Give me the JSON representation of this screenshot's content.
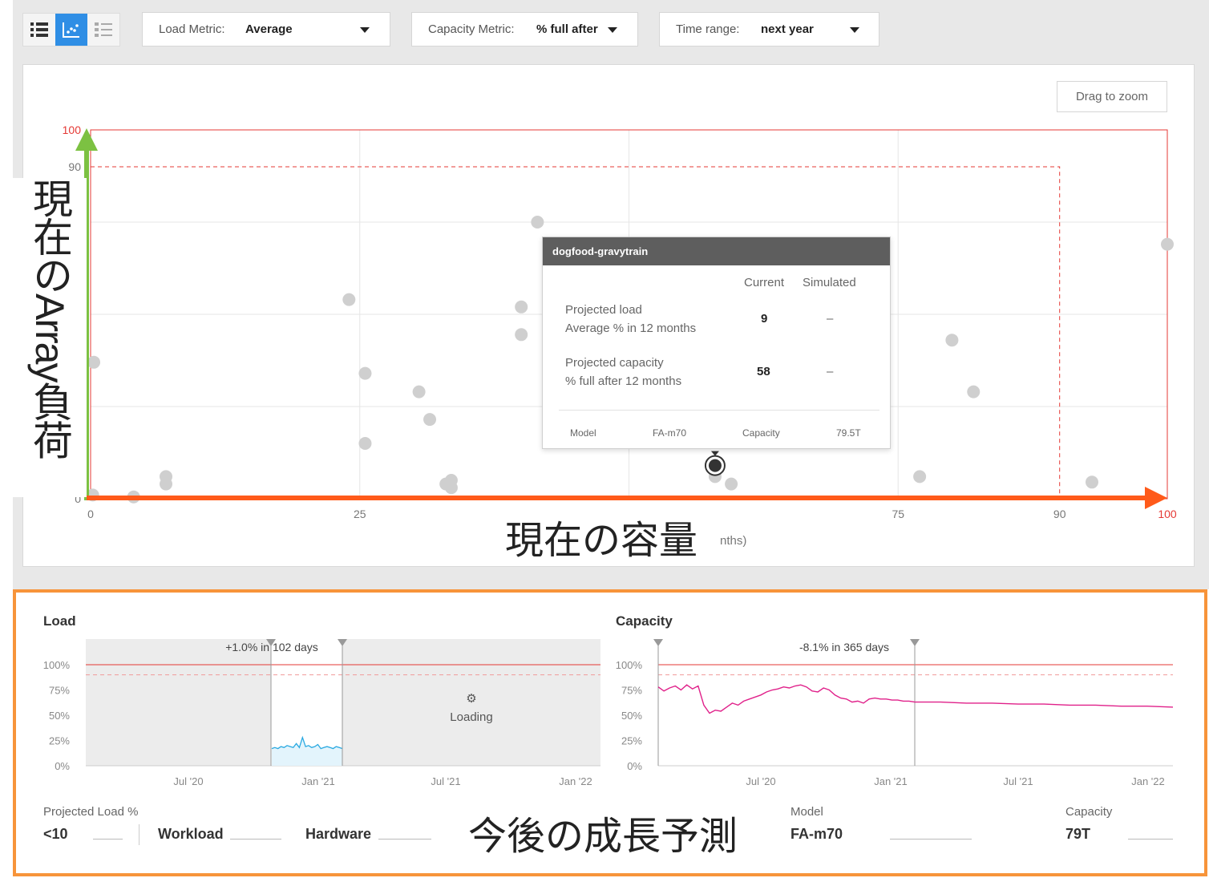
{
  "toolbar": {
    "view_icons": [
      "list-icon",
      "scatter-chart-icon",
      "detail-list-icon"
    ],
    "load_metric": {
      "label": "Load Metric:",
      "value": "Average"
    },
    "capacity_metric": {
      "label": "Capacity Metric:",
      "value": "% full after"
    },
    "time_range": {
      "label": "Time range:",
      "value": "next year"
    }
  },
  "scatter": {
    "zoom_button": "Drag to zoom",
    "x_axis_partial_label": "nths)",
    "accent_color": "#e53935",
    "chart_data": {
      "type": "scatter",
      "x_ticks": [
        "0",
        "25",
        "75",
        "90",
        "100"
      ],
      "y_ticks": [
        "100",
        "90",
        "0"
      ],
      "xlim": [
        0,
        100
      ],
      "ylim": [
        0,
        100
      ],
      "threshold": 90,
      "points": [
        {
          "x": 0.3,
          "y": 37
        },
        {
          "x": 0.2,
          "y": 1
        },
        {
          "x": 4,
          "y": 0.5
        },
        {
          "x": 7,
          "y": 6
        },
        {
          "x": 7,
          "y": 4
        },
        {
          "x": 24,
          "y": 54
        },
        {
          "x": 25.5,
          "y": 34
        },
        {
          "x": 25.5,
          "y": 15
        },
        {
          "x": 30.5,
          "y": 29
        },
        {
          "x": 31.5,
          "y": 21.5
        },
        {
          "x": 33,
          "y": 4
        },
        {
          "x": 33.5,
          "y": 3
        },
        {
          "x": 33.5,
          "y": 5
        },
        {
          "x": 40,
          "y": 52
        },
        {
          "x": 40,
          "y": 44.5
        },
        {
          "x": 41.5,
          "y": 75
        },
        {
          "x": 58,
          "y": 6
        },
        {
          "x": 59.5,
          "y": 4
        },
        {
          "x": 80,
          "y": 43
        },
        {
          "x": 82,
          "y": 29
        },
        {
          "x": 77,
          "y": 6
        },
        {
          "x": 93,
          "y": 4.5
        },
        {
          "x": 100,
          "y": 69
        }
      ],
      "selected_point": {
        "x": 58,
        "y": 9
      }
    }
  },
  "tooltip": {
    "title": "dogfood-gravytrain",
    "col_current": "Current",
    "col_simulated": "Simulated",
    "load_label": "Projected load",
    "load_sub": "Average % in 12 months",
    "load_current": "9",
    "load_simulated": "–",
    "cap_label": "Projected capacity",
    "cap_sub": "% full after 12 months",
    "cap_current": "58",
    "cap_simulated": "–",
    "model_label": "Model",
    "model_value": "FA-m70",
    "capacity_label": "Capacity",
    "capacity_value": "79.5T"
  },
  "annotations": {
    "y_note": "現在のArray負荷",
    "x_note": "現在の容量",
    "bottom_note": "今後の成長予測"
  },
  "load_chart": {
    "title": "Load",
    "annotation": "+1.0% in 102 days",
    "loading": "Loading",
    "y_ticks": [
      "100%",
      "75%",
      "50%",
      "25%",
      "0%"
    ],
    "x_ticks": [
      "Jul '20",
      "Jan '21",
      "Jul '21",
      "Jan '22"
    ],
    "line_color": "#29a9e1",
    "chart_data": {
      "type": "line",
      "ylim": [
        0,
        100
      ],
      "series": [
        {
          "values": [
            17,
            18,
            17,
            19,
            18,
            20,
            19,
            18,
            22,
            18,
            28,
            19,
            20,
            18,
            19,
            21,
            17,
            18,
            19,
            18,
            17,
            19,
            18,
            17
          ]
        }
      ]
    }
  },
  "capacity_chart": {
    "title": "Capacity",
    "annotation": "-8.1% in 365 days",
    "y_ticks": [
      "100%",
      "75%",
      "50%",
      "25%",
      "0%"
    ],
    "x_ticks": [
      "Jul '20",
      "Jan '21",
      "Jul '21",
      "Jan '22"
    ],
    "line_color": "#e0218a",
    "chart_data": {
      "type": "line",
      "ylim": [
        0,
        100
      ],
      "series": [
        {
          "values": [
            78,
            74,
            77,
            79,
            75,
            80,
            76,
            79,
            60,
            52,
            55,
            54,
            58,
            62,
            60,
            64,
            66,
            68,
            70,
            73,
            75,
            76,
            78,
            77,
            79,
            80,
            78,
            74,
            73,
            77,
            75,
            70,
            67,
            66,
            63,
            64,
            62,
            66,
            67,
            66,
            66,
            65,
            65,
            64,
            64,
            63,
            63,
            62,
            62,
            61,
            61,
            60,
            60,
            59,
            59,
            58
          ]
        }
      ]
    }
  },
  "footer": {
    "projected_load_label": "Projected Load %",
    "projected_load_value": "<10",
    "workload": "Workload",
    "hardware": "Hardware",
    "model_label": "Model",
    "model_value": "FA-m70",
    "capacity_label": "Capacity",
    "capacity_value": "79T"
  }
}
